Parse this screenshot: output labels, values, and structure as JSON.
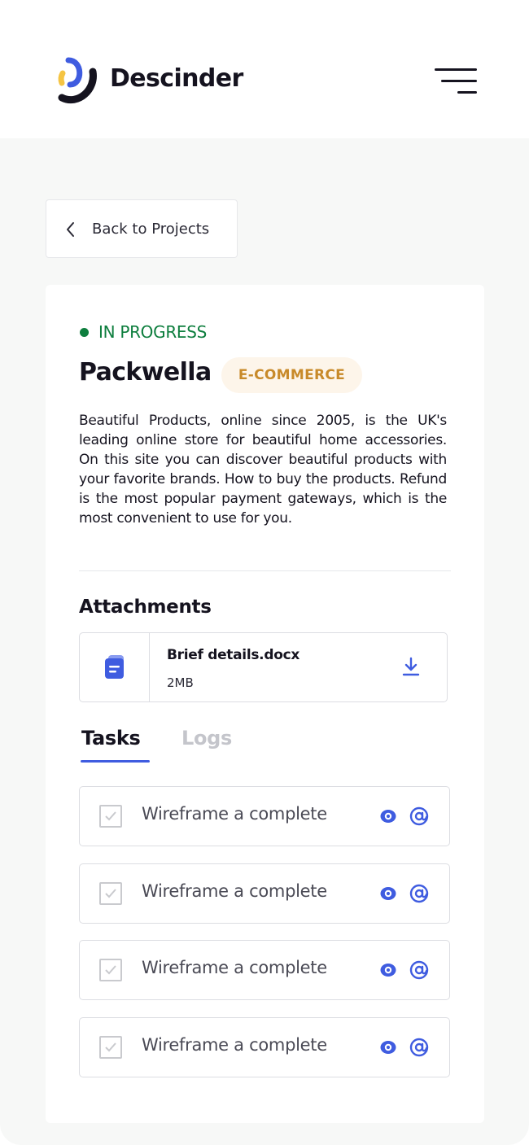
{
  "header": {
    "brand": "Descinder",
    "logo_icon": "descinder-logo",
    "menu_icon": "hamburger-menu-icon"
  },
  "back_button": {
    "label": "Back to Projects",
    "icon": "chevron-left-icon"
  },
  "project": {
    "status": "IN PROGRESS",
    "status_color": "#0e7e3e",
    "title": "Packwella",
    "category": "E-COMMERCE",
    "category_color": "#c88a2a",
    "description": "Beautiful Products, online since 2005, is the UK's leading online store for beautiful home accessories. On this site you can discover beautiful products with your favorite brands. How to buy the products. Refund is the most popular payment gateways, which is the most convenient to use for you."
  },
  "attachments": {
    "heading": "Attachments",
    "items": [
      {
        "name": "Brief details.docx",
        "size": "2MB",
        "icon": "document-icon",
        "action_icon": "download-icon"
      }
    ]
  },
  "tabs": [
    {
      "label": "Tasks",
      "active": true
    },
    {
      "label": "Logs",
      "active": false
    }
  ],
  "tasks": [
    {
      "label": "Wireframe a complete"
    },
    {
      "label": "Wireframe a complete"
    },
    {
      "label": "Wireframe a complete"
    },
    {
      "label": "Wireframe a complete"
    }
  ],
  "colors": {
    "accent": "#3f5ce0",
    "logo_yellow": "#f5c443",
    "logo_blue": "#3f5ce0",
    "text": "#15131f"
  }
}
